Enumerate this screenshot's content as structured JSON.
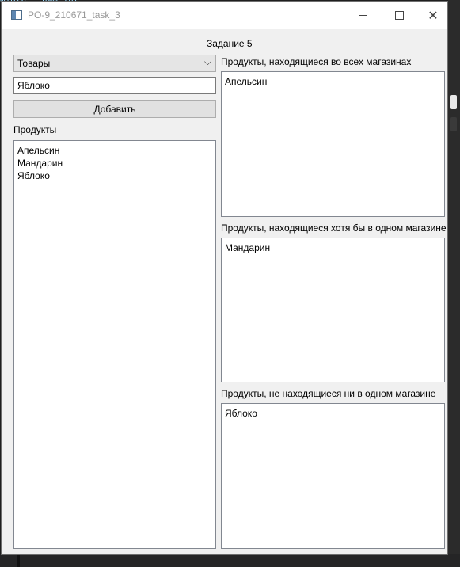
{
  "window": {
    "title": "PO-9_210671_task_3",
    "controls": {
      "minimize": "minimize-icon",
      "maximize": "maximize-icon",
      "close": "close-icon"
    }
  },
  "header": {
    "title": "Задание 5"
  },
  "left": {
    "category_select": {
      "selected": "Товары"
    },
    "product_input": {
      "value": "Яблоко"
    },
    "add_button": {
      "label": "Добавить"
    },
    "products_label": "Продукты",
    "products": [
      "Апельсин",
      "Мандарин",
      "Яблоко"
    ]
  },
  "right": {
    "all_stores": {
      "label": "Продукты, находящиеся во всех магазинах",
      "items": [
        "Апельсин"
      ]
    },
    "any_store": {
      "label": "Продукты, находящиеся хотя бы в одном магазине",
      "items": [
        "Мандарин"
      ]
    },
    "no_store": {
      "label": "Продукты, не находящиеся ни в одном магазине",
      "items": [
        "Яблоко"
      ]
    }
  },
  "colors": {
    "window_bg": "#f0f0f0",
    "titlebar_bg": "#ffffff",
    "list_bg": "#ffffff",
    "button_bg": "#e1e1e1"
  }
}
